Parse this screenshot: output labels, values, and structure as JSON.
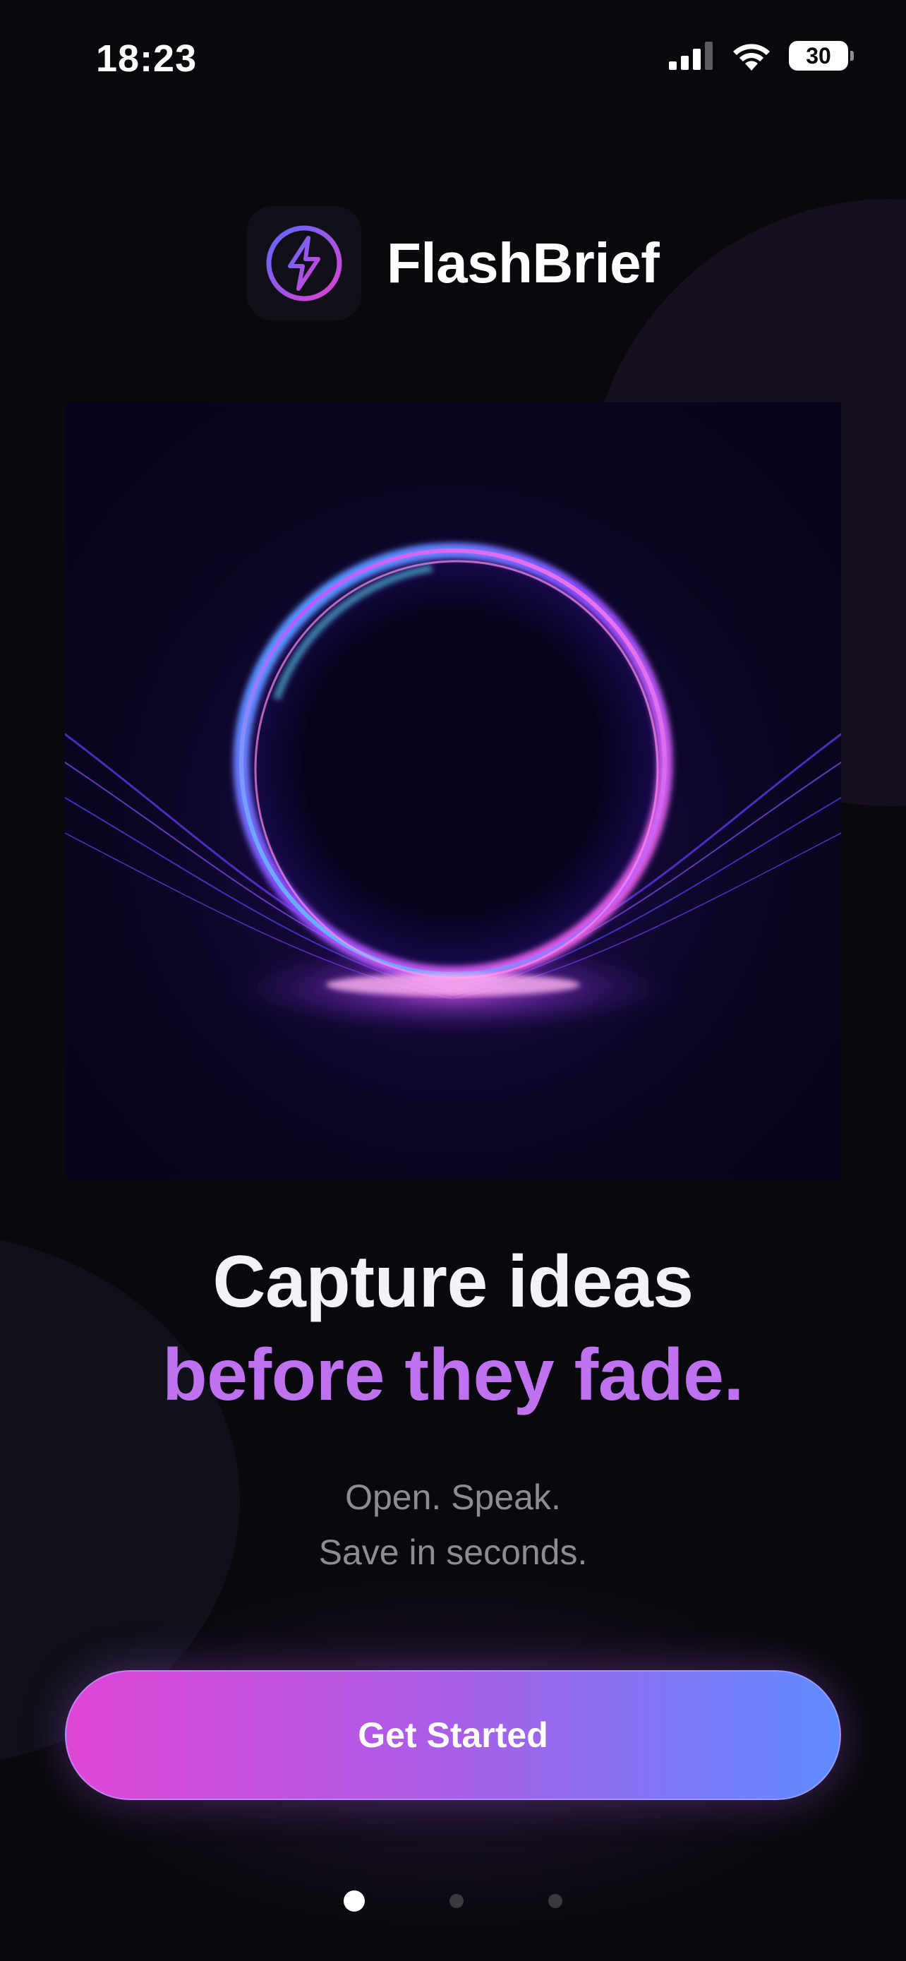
{
  "status_bar": {
    "time": "18:23",
    "battery": "30",
    "icons": [
      "cellular-signal-icon",
      "wifi-icon",
      "battery-icon"
    ]
  },
  "brand": {
    "app_name": "FlashBrief",
    "icon": "lightning-bolt-icon"
  },
  "hero": {
    "illustration": "glowing-orb"
  },
  "headline": {
    "line1": "Capture ideas",
    "line2": "before they fade."
  },
  "subtext": {
    "line1": "Open. Speak.",
    "line2": "Save in seconds."
  },
  "cta": {
    "label": "Get Started"
  },
  "pagination": {
    "total": 3,
    "active": 1
  },
  "colors": {
    "background": "#09080c",
    "headline_white": "#f4f2f7",
    "headline_accent": "#be72f0",
    "button_gradient_start": "#e046d6",
    "button_gradient_end": "#5f8bff"
  }
}
